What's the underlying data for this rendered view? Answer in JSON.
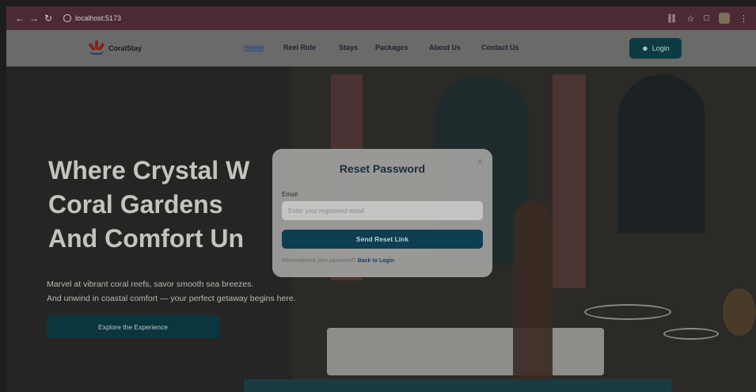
{
  "browser": {
    "url": "localhost:5173",
    "back_icon": "back-arrow-icon",
    "forward_icon": "forward-arrow-icon",
    "reload_icon": "reload-icon"
  },
  "navbar": {
    "brand": "CoralStay",
    "links": [
      "Home",
      "Reel Ride",
      "Stays",
      "Packages",
      "About Us",
      "Contact Us"
    ],
    "active_link": "Home",
    "login_label": "Login"
  },
  "hero": {
    "title_line1": "Where Crystal W",
    "title_line2": "Coral Gardens",
    "title_line3": "And Comfort Un",
    "subtitle_line1": "Marvel at vibrant coral reefs, savor smooth sea breezes.",
    "subtitle_line2": "And unwind in coastal comfort — your perfect getaway begins here.",
    "cta_label": "Explore the Experience"
  },
  "modal": {
    "title": "Reset Password",
    "close_symbol": "×",
    "email_label": "Email",
    "email_placeholder": "Enter your registered email",
    "submit_label": "Send Reset Link",
    "footer_text": "Remembered your password?",
    "footer_link": "Back to Login"
  },
  "colors": {
    "navbar_bg": "#6a6a68",
    "login_bg": "#0c3b43",
    "submit_bg": "#0e3e51",
    "chrome_bg": "#4c2a35"
  }
}
